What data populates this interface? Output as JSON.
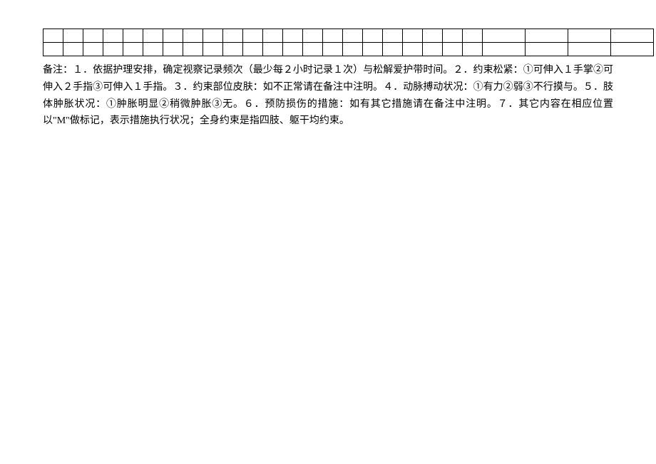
{
  "table": {
    "rows": 2,
    "narrow_cols": 22,
    "wide_cols": 4
  },
  "notes": {
    "prefix": "备注：",
    "items": [
      "１．依据护理安排，确定视察记录频次（最少每２小时记录１次）与松解爱护带时间。",
      "２．约束松紧：①可伸入１手掌②可伸入２手指③可伸入１手指。",
      "３．约束部位皮肤：如不正常请在备注中注明。",
      "４．动脉搏动状况：①有力②弱③不行摸与。",
      "５．肢体肿胀状况：①肿胀明显②稍微肿胀③无。",
      "６．预防损伤的措施：如有其它措施请在备注中注明。",
      "７．其它内容在相应位置以\"M\"做标记，表示措施执行状况；全身约束是指四肢、躯干均约束。"
    ]
  }
}
